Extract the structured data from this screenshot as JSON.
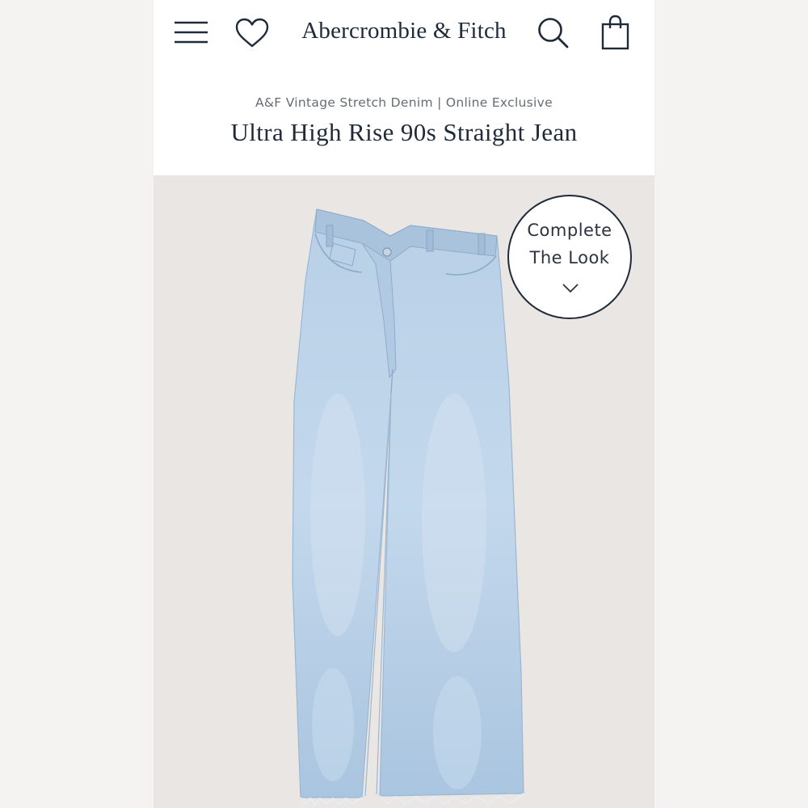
{
  "header": {
    "brand": "Abercrombie & Fitch",
    "icons": [
      "menu-icon",
      "heart-icon",
      "search-icon",
      "bag-icon"
    ]
  },
  "product": {
    "subtitle": "A&F Vintage Stretch Denim | Online Exclusive",
    "title": "Ultra High Rise 90s Straight Jean"
  },
  "complete_look": {
    "line1": "Complete",
    "line2": "The Look",
    "icon": "chevron-down-icon"
  },
  "colors": {
    "brand_navy": "#1f2a3a",
    "image_background": "#eae6e3",
    "denim": "#b4cde4"
  }
}
